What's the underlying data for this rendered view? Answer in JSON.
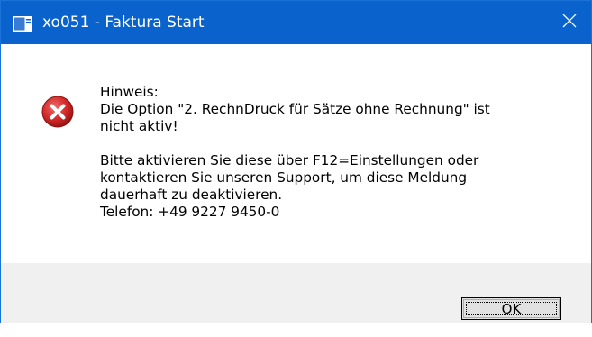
{
  "window": {
    "title": "xo051 - Faktura Start",
    "accent_color": "#0a62cc",
    "icons": {
      "app": "application-window-icon",
      "close": "close-icon",
      "message": "error-icon"
    }
  },
  "message": {
    "lines": [
      "Hinweis:",
      "Die Option \"2. RechnDruck für Sätze ohne Rechnung\" ist",
      "nicht aktiv!",
      "",
      "Bitte aktivieren Sie diese über F12=Einstellungen oder",
      "kontaktieren Sie unseren Support, um diese Meldung",
      "dauerhaft zu deaktivieren.",
      "Telefon: +49 9227 9450-0"
    ]
  },
  "buttons": {
    "ok_label": "OK"
  }
}
